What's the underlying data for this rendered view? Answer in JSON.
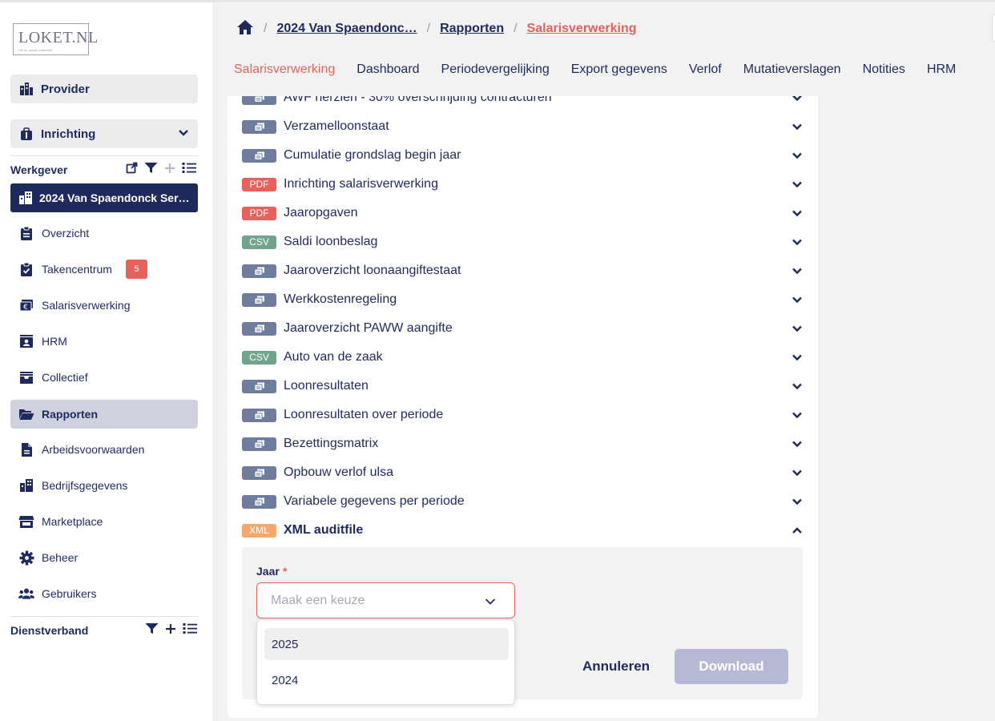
{
  "logo": {
    "text": "LOKET.NL",
    "sub": "HR en salaris makkelijk"
  },
  "sidebar": {
    "provider_label": "Provider",
    "inrichting_label": "Inrichting",
    "werkgever_title": "Werkgever",
    "employer_name": "2024 Van Spaendonck Ser…",
    "items": [
      {
        "label": "Overzicht",
        "icon": "clipboard-icon"
      },
      {
        "label": "Takencentrum",
        "icon": "clipboard-check-icon",
        "badge": "5"
      },
      {
        "label": "Salarisverwerking",
        "icon": "euro-bill-icon"
      },
      {
        "label": "HRM",
        "icon": "id-card-icon"
      },
      {
        "label": "Collectief",
        "icon": "inbox-icon"
      },
      {
        "label": "Rapporten",
        "icon": "folder-open-icon"
      },
      {
        "label": "Arbeidsvoorwaarden",
        "icon": "document-icon"
      },
      {
        "label": "Bedrijfsgegevens",
        "icon": "building-icon"
      },
      {
        "label": "Marketplace",
        "icon": "store-icon"
      },
      {
        "label": "Beheer",
        "icon": "gear-icon"
      },
      {
        "label": "Gebruikers",
        "icon": "users-icon"
      }
    ],
    "dienstverband_title": "Dienstverband"
  },
  "breadcrumb": {
    "employer": "2024 Van Spaendonc…",
    "rapporten": "Rapporten",
    "current": "Salarisverwerking"
  },
  "tabs": [
    "Salarisverwerking",
    "Dashboard",
    "Periodevergelijking",
    "Export gegevens",
    "Verlof",
    "Mutatieverslagen",
    "Notities",
    "HRM"
  ],
  "reports": [
    {
      "type": "gen",
      "tag": "",
      "label": "AWF herzien - 30% overschrijding contracturen"
    },
    {
      "type": "gen",
      "tag": "",
      "label": "Verzamelloonstaat"
    },
    {
      "type": "gen",
      "tag": "",
      "label": "Cumulatie grondslag begin jaar"
    },
    {
      "type": "pdf",
      "tag": "PDF",
      "label": "Inrichting salarisverwerking"
    },
    {
      "type": "pdf",
      "tag": "PDF",
      "label": "Jaaropgaven"
    },
    {
      "type": "csv",
      "tag": "CSV",
      "label": "Saldi loonbeslag"
    },
    {
      "type": "gen",
      "tag": "",
      "label": "Jaaroverzicht loonaangiftestaat"
    },
    {
      "type": "gen",
      "tag": "",
      "label": "Werkkostenregeling"
    },
    {
      "type": "gen",
      "tag": "",
      "label": "Jaaroverzicht PAWW aangifte"
    },
    {
      "type": "csv",
      "tag": "CSV",
      "label": "Auto van de zaak"
    },
    {
      "type": "gen",
      "tag": "",
      "label": "Loonresultaten"
    },
    {
      "type": "gen",
      "tag": "",
      "label": "Loonresultaten over periode"
    },
    {
      "type": "gen",
      "tag": "",
      "label": "Bezettingsmatrix"
    },
    {
      "type": "gen",
      "tag": "",
      "label": "Opbouw verlof ulsa"
    },
    {
      "type": "gen",
      "tag": "",
      "label": "Variabele gegevens per periode"
    },
    {
      "type": "xml",
      "tag": "XML",
      "label": "XML auditfile",
      "expanded": true
    }
  ],
  "form": {
    "jaar_label": "Jaar",
    "required_mark": "*",
    "placeholder": "Maak een keuze",
    "options": [
      "2025",
      "2024"
    ],
    "cancel_label": "Annuleren",
    "download_label": "Download"
  },
  "colors": {
    "navy": "#1f2a5c",
    "accent": "#e5625c",
    "csv": "#71a48b",
    "xml": "#f3a86e",
    "gen": "#6f7c9e",
    "disabled": "#b6b9d4"
  }
}
